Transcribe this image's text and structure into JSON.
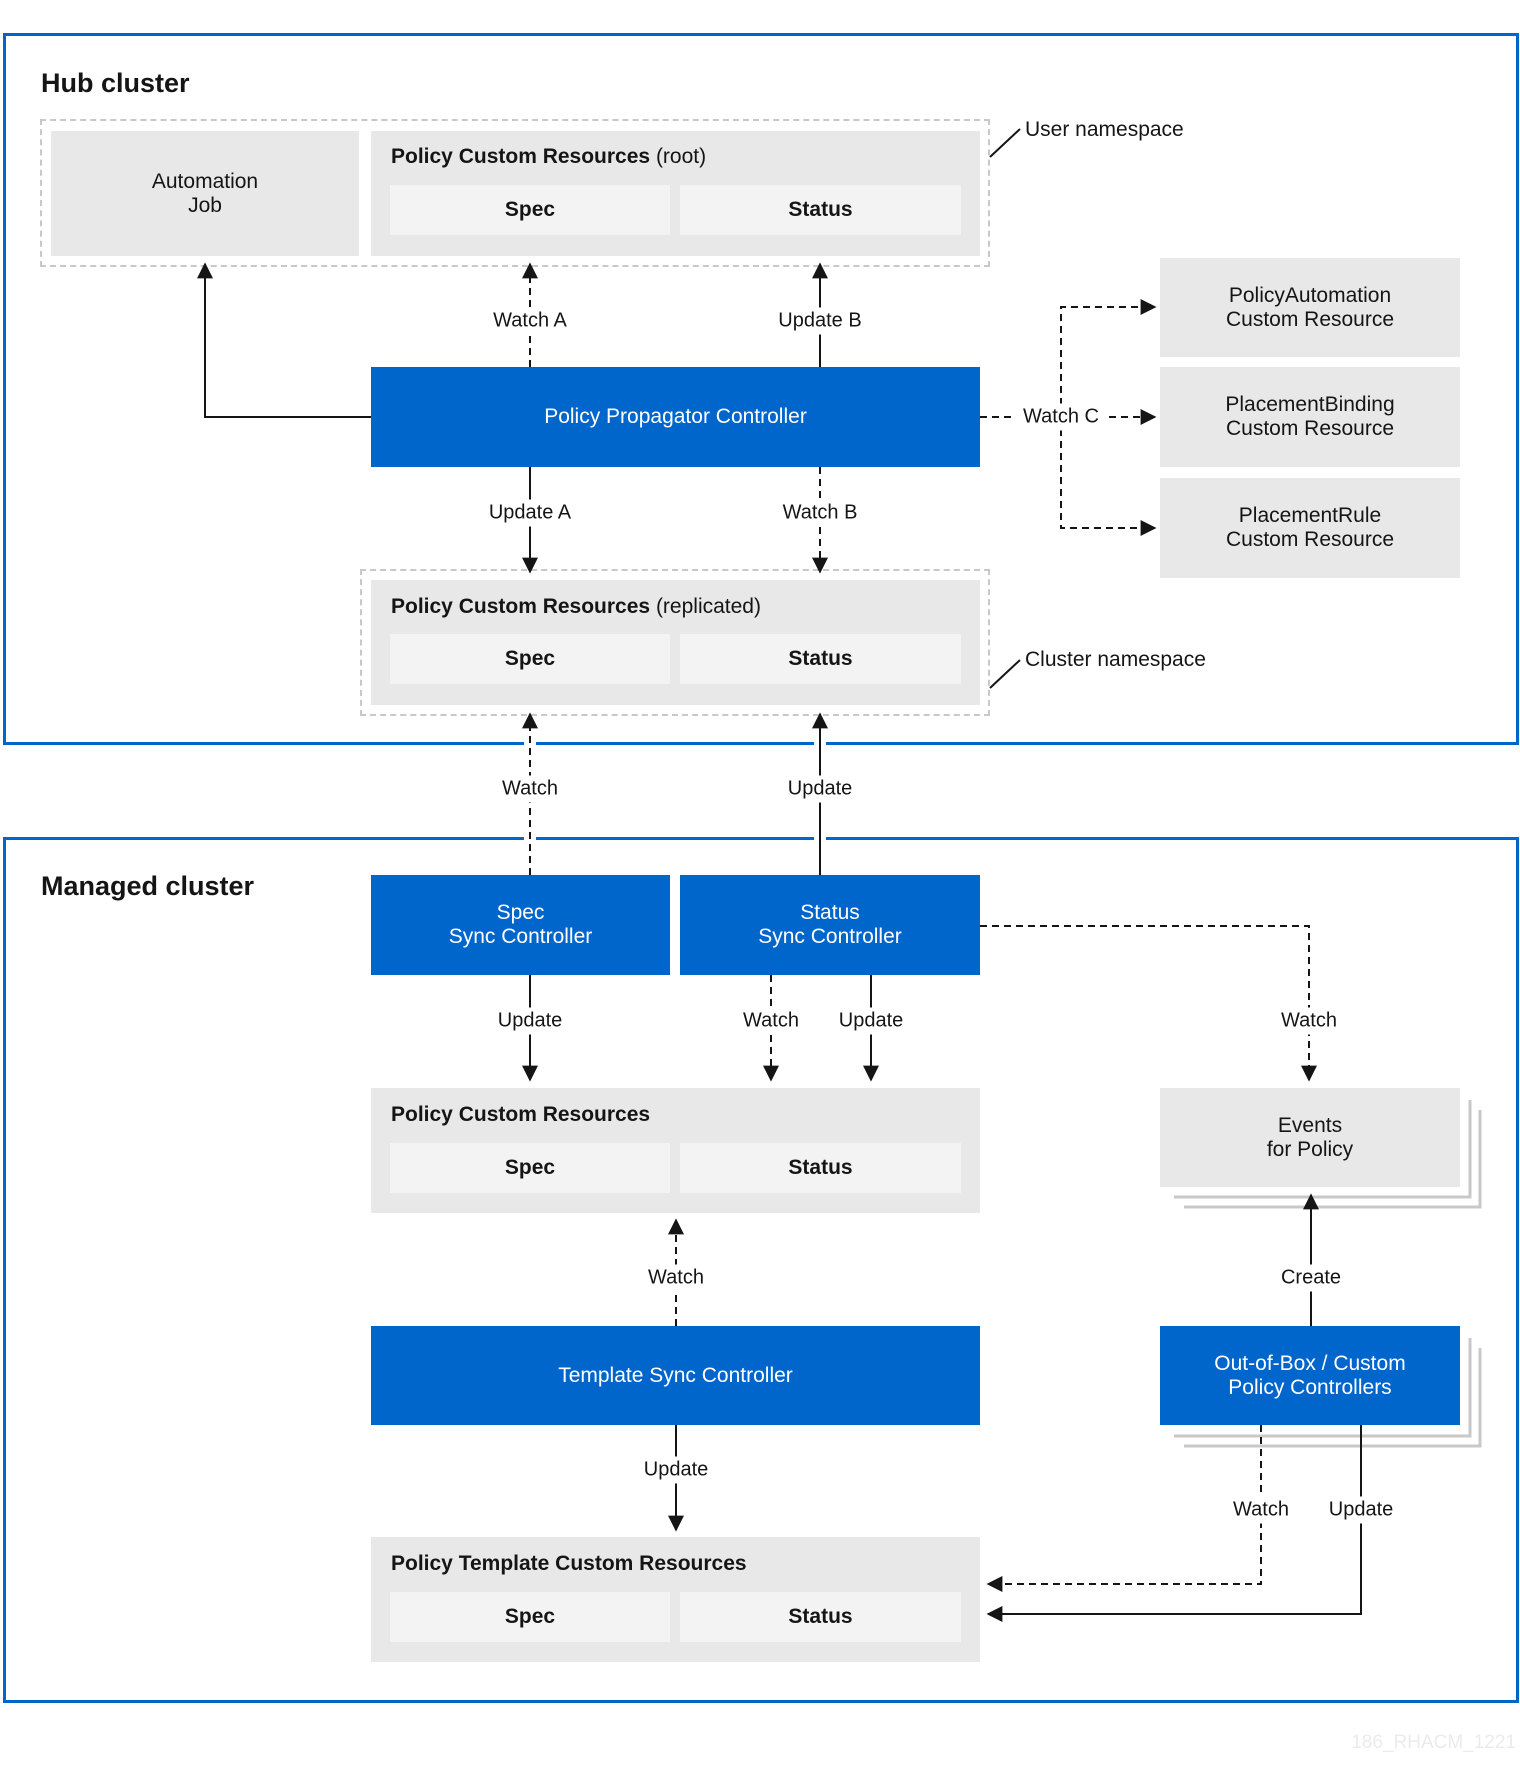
{
  "hub": {
    "title": "Hub cluster",
    "user_namespace_label": "User namespace",
    "cluster_namespace_label": "Cluster namespace",
    "automation_job": "Automation\nJob",
    "policy_root": {
      "title": "Policy Custom Resources",
      "qualifier": "(root)",
      "spec": "Spec",
      "status": "Status"
    },
    "propagator": "Policy Propagator Controller",
    "policy_replicated": {
      "title": "Policy Custom Resources",
      "qualifier": "(replicated)",
      "spec": "Spec",
      "status": "Status"
    },
    "side_resources": [
      "PolicyAutomation\nCustom Resource",
      "PlacementBinding\nCustom Resource",
      "PlacementRule\nCustom Resource"
    ],
    "edges": {
      "watch_a": "Watch A",
      "update_b": "Update B",
      "update_a": "Update A",
      "watch_b": "Watch B",
      "watch_c": "Watch C"
    }
  },
  "between": {
    "watch": "Watch",
    "update": "Update"
  },
  "managed": {
    "title": "Managed cluster",
    "spec_sync": "Spec\nSync Controller",
    "status_sync": "Status\nSync Controller",
    "policy": {
      "title": "Policy Custom Resources",
      "spec": "Spec",
      "status": "Status"
    },
    "events": "Events\nfor Policy",
    "template_sync": "Template Sync Controller",
    "oob": "Out-of-Box / Custom\nPolicy Controllers",
    "template_policy": {
      "title": "Policy Template Custom Resources",
      "spec": "Spec",
      "status": "Status"
    },
    "edges": {
      "spec_update": "Update",
      "status_watch": "Watch",
      "status_update": "Update",
      "events_watch": "Watch",
      "template_watch": "Watch",
      "template_update": "Update",
      "create": "Create",
      "oob_watch": "Watch",
      "oob_update": "Update"
    }
  },
  "watermark": "186_RHACM_1221",
  "colors": {
    "blue": "#0066cc",
    "box_gray": "#e8e8e8",
    "sub_gray": "#f3f3f3",
    "dash_gray": "#c8c8c8"
  }
}
